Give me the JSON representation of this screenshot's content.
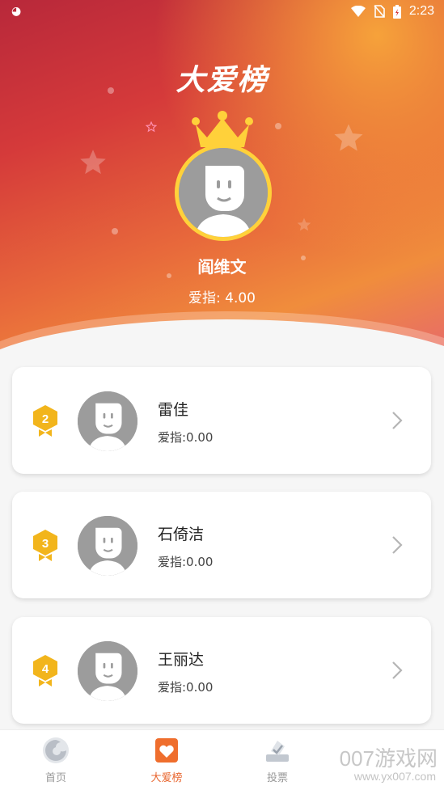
{
  "status_bar": {
    "time": "2:23"
  },
  "hero": {
    "title": "大爱榜",
    "top_user": {
      "name": "阎维文",
      "score_text": "爱指: 4.00"
    }
  },
  "ranking": [
    {
      "rank": "2",
      "name": "雷佳",
      "score_text": "爱指:0.00"
    },
    {
      "rank": "3",
      "name": "石倚洁",
      "score_text": "爱指:0.00"
    },
    {
      "rank": "4",
      "name": "王丽达",
      "score_text": "爱指:0.00"
    }
  ],
  "tabbar": {
    "tabs": [
      {
        "label": "首页",
        "icon": "home-icon",
        "active": false
      },
      {
        "label": "大爱榜",
        "icon": "heart-card-icon",
        "active": true
      },
      {
        "label": "投票",
        "icon": "vote-icon",
        "active": false
      }
    ]
  },
  "watermark": {
    "main": "007游戏网",
    "sub": "www.yx007.com"
  },
  "colors": {
    "accent": "#e8662f",
    "badge": "#f2b51c",
    "crown": "#ffd13a"
  }
}
